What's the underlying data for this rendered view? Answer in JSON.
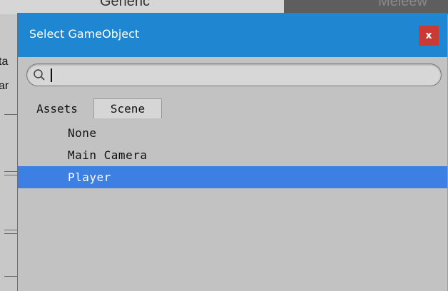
{
  "background": {
    "top_left_text": "Generic",
    "top_right_text": "Meleew",
    "left_fragments": [
      "ta",
      "ar"
    ]
  },
  "window": {
    "title": "Select GameObject",
    "close_label": "x"
  },
  "search": {
    "value": "",
    "placeholder": ""
  },
  "tabs": [
    {
      "label": "Assets",
      "active": false
    },
    {
      "label": "Scene",
      "active": true
    }
  ],
  "list": {
    "items": [
      {
        "label": "None",
        "selected": false
      },
      {
        "label": "Main Camera",
        "selected": false
      },
      {
        "label": "Player",
        "selected": true
      }
    ]
  },
  "colors": {
    "titlebar": "#1f86d1",
    "close": "#c93a34",
    "selection": "#3e7fe3",
    "panel": "#c2c2c2"
  }
}
